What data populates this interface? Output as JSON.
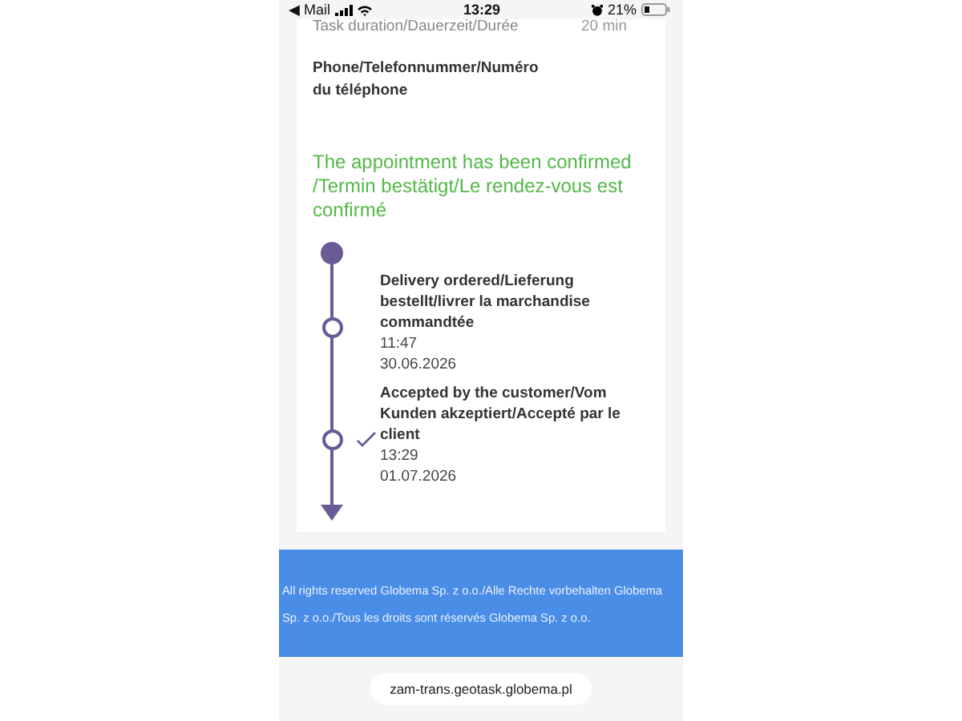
{
  "status_bar": {
    "back": "◀ Mail",
    "time": "13:29",
    "battery": "21%"
  },
  "details": [
    {
      "label": "Task duration/Dauerzeit/Durée",
      "value": "20 min"
    },
    {
      "label": "Phone/Telefonnummer/Numéro du téléphone"
    }
  ],
  "confirmation": "The appointment has been confirmed /Termin bestätigt/Le rendez-vous est confirmé",
  "timeline": [
    {
      "kind": "start"
    },
    {
      "kind": "event",
      "title": "Delivery ordered/Lieferung bestellt/livrer la marchandise commandtée",
      "time": "11:47",
      "date": "30.06.2026",
      "checked": false
    },
    {
      "kind": "event",
      "title": "Accepted by the customer/Vom Kunden akzeptiert/Accepté par le client",
      "time": "13:29",
      "date": "01.07.2026",
      "checked": true
    },
    {
      "kind": "end"
    }
  ],
  "footer": "All rights reserved Globema Sp. z o.o./Alle Rechte vorbehalten Globema Sp. z o.o./Tous les droits sont réservés Globema Sp. z o.o.",
  "url": "zam-trans.geotask.globema.pl"
}
